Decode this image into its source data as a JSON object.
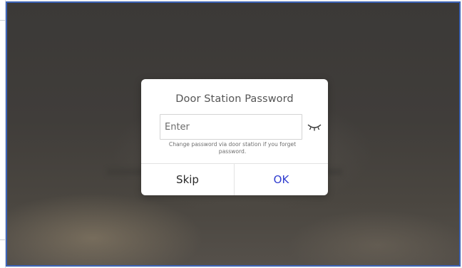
{
  "dialog": {
    "title": "Door Station Password",
    "password_field": {
      "placeholder": "Enter",
      "value": ""
    },
    "show_password_icon": "eye-closed-icon",
    "hint": "Change password via door station if you forget password.",
    "buttons": {
      "skip_label": "Skip",
      "ok_label": "OK"
    }
  },
  "colors": {
    "frame_border": "#3b62b6",
    "ok_text": "#2f3ccf",
    "dialog_background": "#ffffff"
  }
}
